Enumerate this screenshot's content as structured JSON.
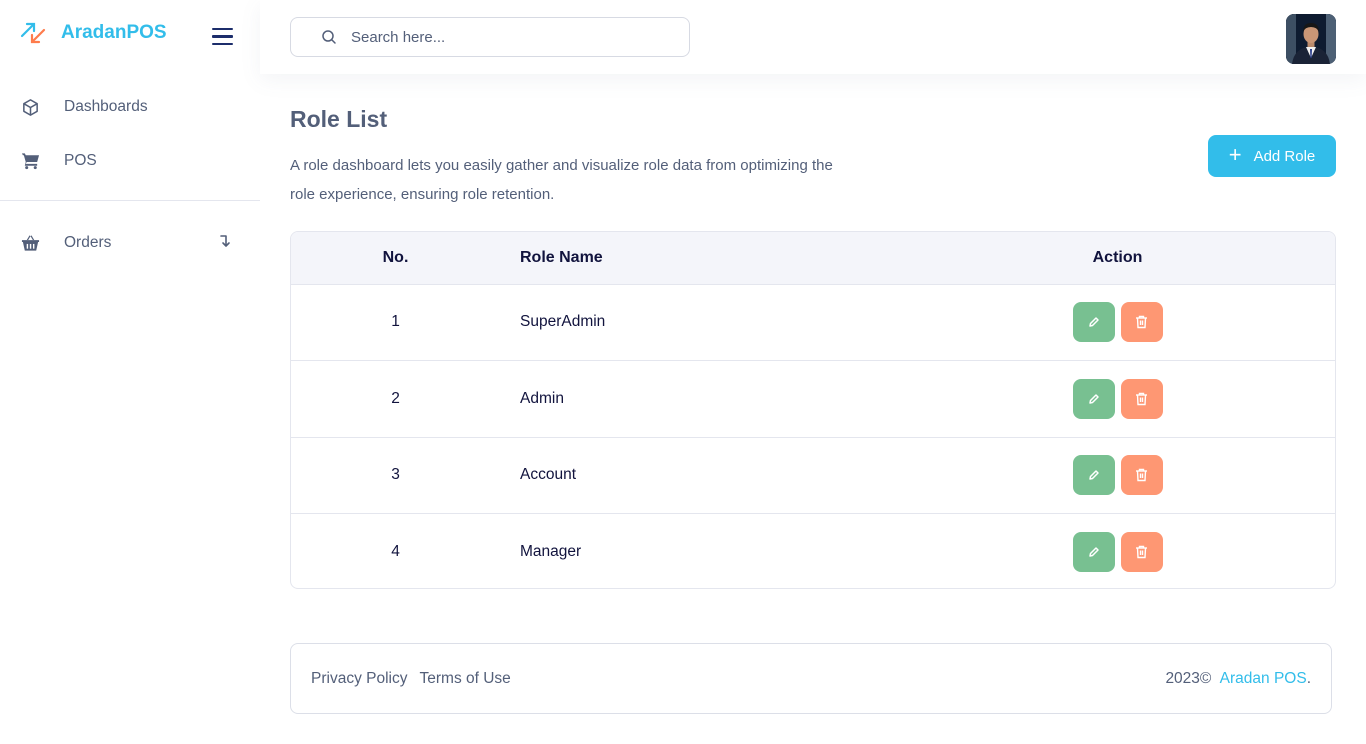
{
  "app": {
    "brand_name": "AradanPOS",
    "colors": {
      "accent": "#32bdea",
      "edit": "#78c091",
      "delete": "#fe9773",
      "heading": "#11133d"
    }
  },
  "sidebar": {
    "items": [
      {
        "label": "Dashboards",
        "icon": "cube-icon"
      },
      {
        "label": "POS",
        "icon": "cart-icon"
      },
      {
        "label": "Orders",
        "icon": "basket-icon"
      }
    ]
  },
  "header": {
    "search_placeholder": "Search here..."
  },
  "main": {
    "title": "Role List",
    "description": "A role dashboard lets you easily gather and visualize role data from optimizing the role experience, ensuring role retention.",
    "add_button_label": "Add Role",
    "table": {
      "columns": [
        "No.",
        "Role Name",
        "Action"
      ],
      "rows": [
        {
          "no": "1",
          "name": "SuperAdmin"
        },
        {
          "no": "2",
          "name": "Admin"
        },
        {
          "no": "3",
          "name": "Account"
        },
        {
          "no": "4",
          "name": "Manager"
        }
      ]
    }
  },
  "footer": {
    "privacy": "Privacy Policy",
    "terms": "Terms of Use",
    "copyright": "2023©",
    "brand_link": "Aradan POS",
    "suffix": "."
  }
}
